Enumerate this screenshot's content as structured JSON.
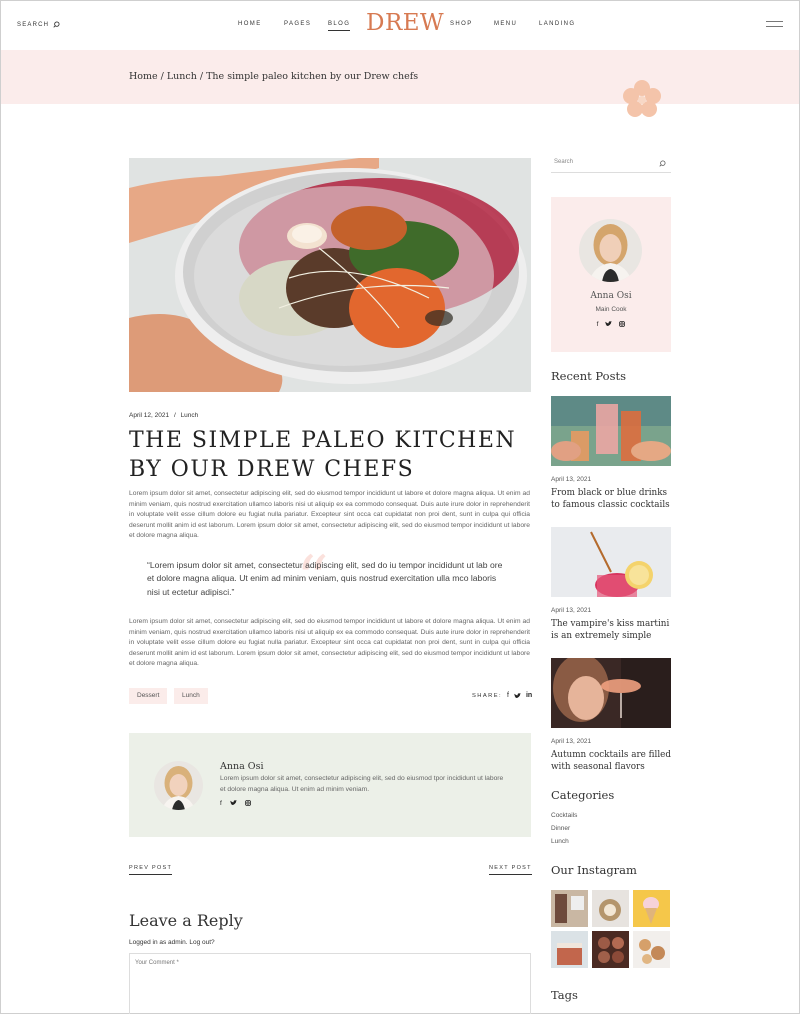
{
  "header": {
    "search_label": "SEARCH",
    "nav": [
      "HOME",
      "PAGES",
      "BLOG",
      "SHOP",
      "MENU",
      "LANDING"
    ],
    "logo": "DREW"
  },
  "breadcrumb": "Home / Lunch / The simple paleo kitchen by our Drew chefs",
  "post": {
    "date": "April 12, 2021",
    "separator": "/",
    "category": "Lunch",
    "title": "THE SIMPLE PALEO KITCHEN BY OUR DREW CHEFS",
    "paragraph_1": "Lorem ipsum dolor sit amet, consectetur adipiscing elit, sed do eiusmod tempor incididunt ut labore et dolore magna aliqua. Ut enim ad minim veniam, quis nostrud exercitation ullamco laboris nisi ut aliquip ex ea commodo consequat. Duis aute irure dolor in reprehenderit in voluptate velit esse cillum dolore eu fugiat nulla pariatur. Excepteur sint occa cat cupidatat non proi dent, sunt in culpa qui officia deserunt mollit anim id est laborum. Lorem ipsum dolor sit amet, consectetur adipiscing elit, sed do eiusmod tempor incididunt ut labore et dolore magna aliqua.",
    "quote": "“Lorem ipsum dolor sit amet, consectetur adipiscing elit, sed do iu tempor incididunt ut lab ore et dolore magna aliqua. Ut enim ad minim veniam, quis nostrud exercitation ulla mco laboris nisi ut ectetur adipisci.”",
    "paragraph_2": "Lorem ipsum dolor sit amet, consectetur adipiscing elit, sed do eiusmod tempor incididunt ut labore et dolore magna aliqua. Ut enim ad minim veniam, quis nostrud exercitation ullamco laboris nisi ut aliquip ex ea commodo consequat. Duis aute irure dolor in reprehenderit in voluptate velit esse cillum dolore eu fugiat nulla pariatur. Excepteur sint occa cat cupidatat non proi dent, sunt in culpa qui officia deserunt mollit anim id est laborum. Lorem ipsum dolor sit amet, consectetur adipiscing elit, sed do eiusmod tempor incididunt ut labore et dolore magna aliqua.",
    "tags": [
      "Dessert",
      "Lunch"
    ],
    "share_label": "SHARE:"
  },
  "author": {
    "name": "Anna Osi",
    "bio": "Lorem ipsum dolor sit amet, consectetur adipiscing elit, sed do eiusmod tpor incididunt ut labore et dolore magna aliqua. Ut enim ad minim veniam."
  },
  "pagination": {
    "prev": "PREV POST",
    "next": "NEXT POST"
  },
  "reply": {
    "title": "Leave a Reply",
    "logged_in": "Logged in as admin. Log out?",
    "comment_placeholder": "Your Comment *"
  },
  "sidebar": {
    "search_placeholder": "Search",
    "profile": {
      "name": "Anna Osi",
      "role": "Main Cook"
    },
    "recent_heading": "Recent Posts",
    "recent_posts": [
      {
        "date": "April 13, 2021",
        "title": "From black or blue drinks to famous classic cocktails"
      },
      {
        "date": "April 13, 2021",
        "title": "The vampire's kiss martini is an extremely simple"
      },
      {
        "date": "April 13, 2021",
        "title": "Autumn cocktails are filled with seasonal flavors"
      }
    ],
    "categories_heading": "Categories",
    "categories": [
      "Cocktails",
      "Dinner",
      "Lunch"
    ],
    "instagram_heading": "Our Instagram",
    "tags_heading": "Tags"
  },
  "colors": {
    "accent": "#d77a52",
    "band": "#fbeceb",
    "author_bg": "#ecf0e8"
  },
  "icons": [
    "search-icon",
    "hamburger-icon",
    "flower-icon",
    "facebook-icon",
    "twitter-icon",
    "instagram-icon",
    "linkedin-icon",
    "quote-icon"
  ]
}
